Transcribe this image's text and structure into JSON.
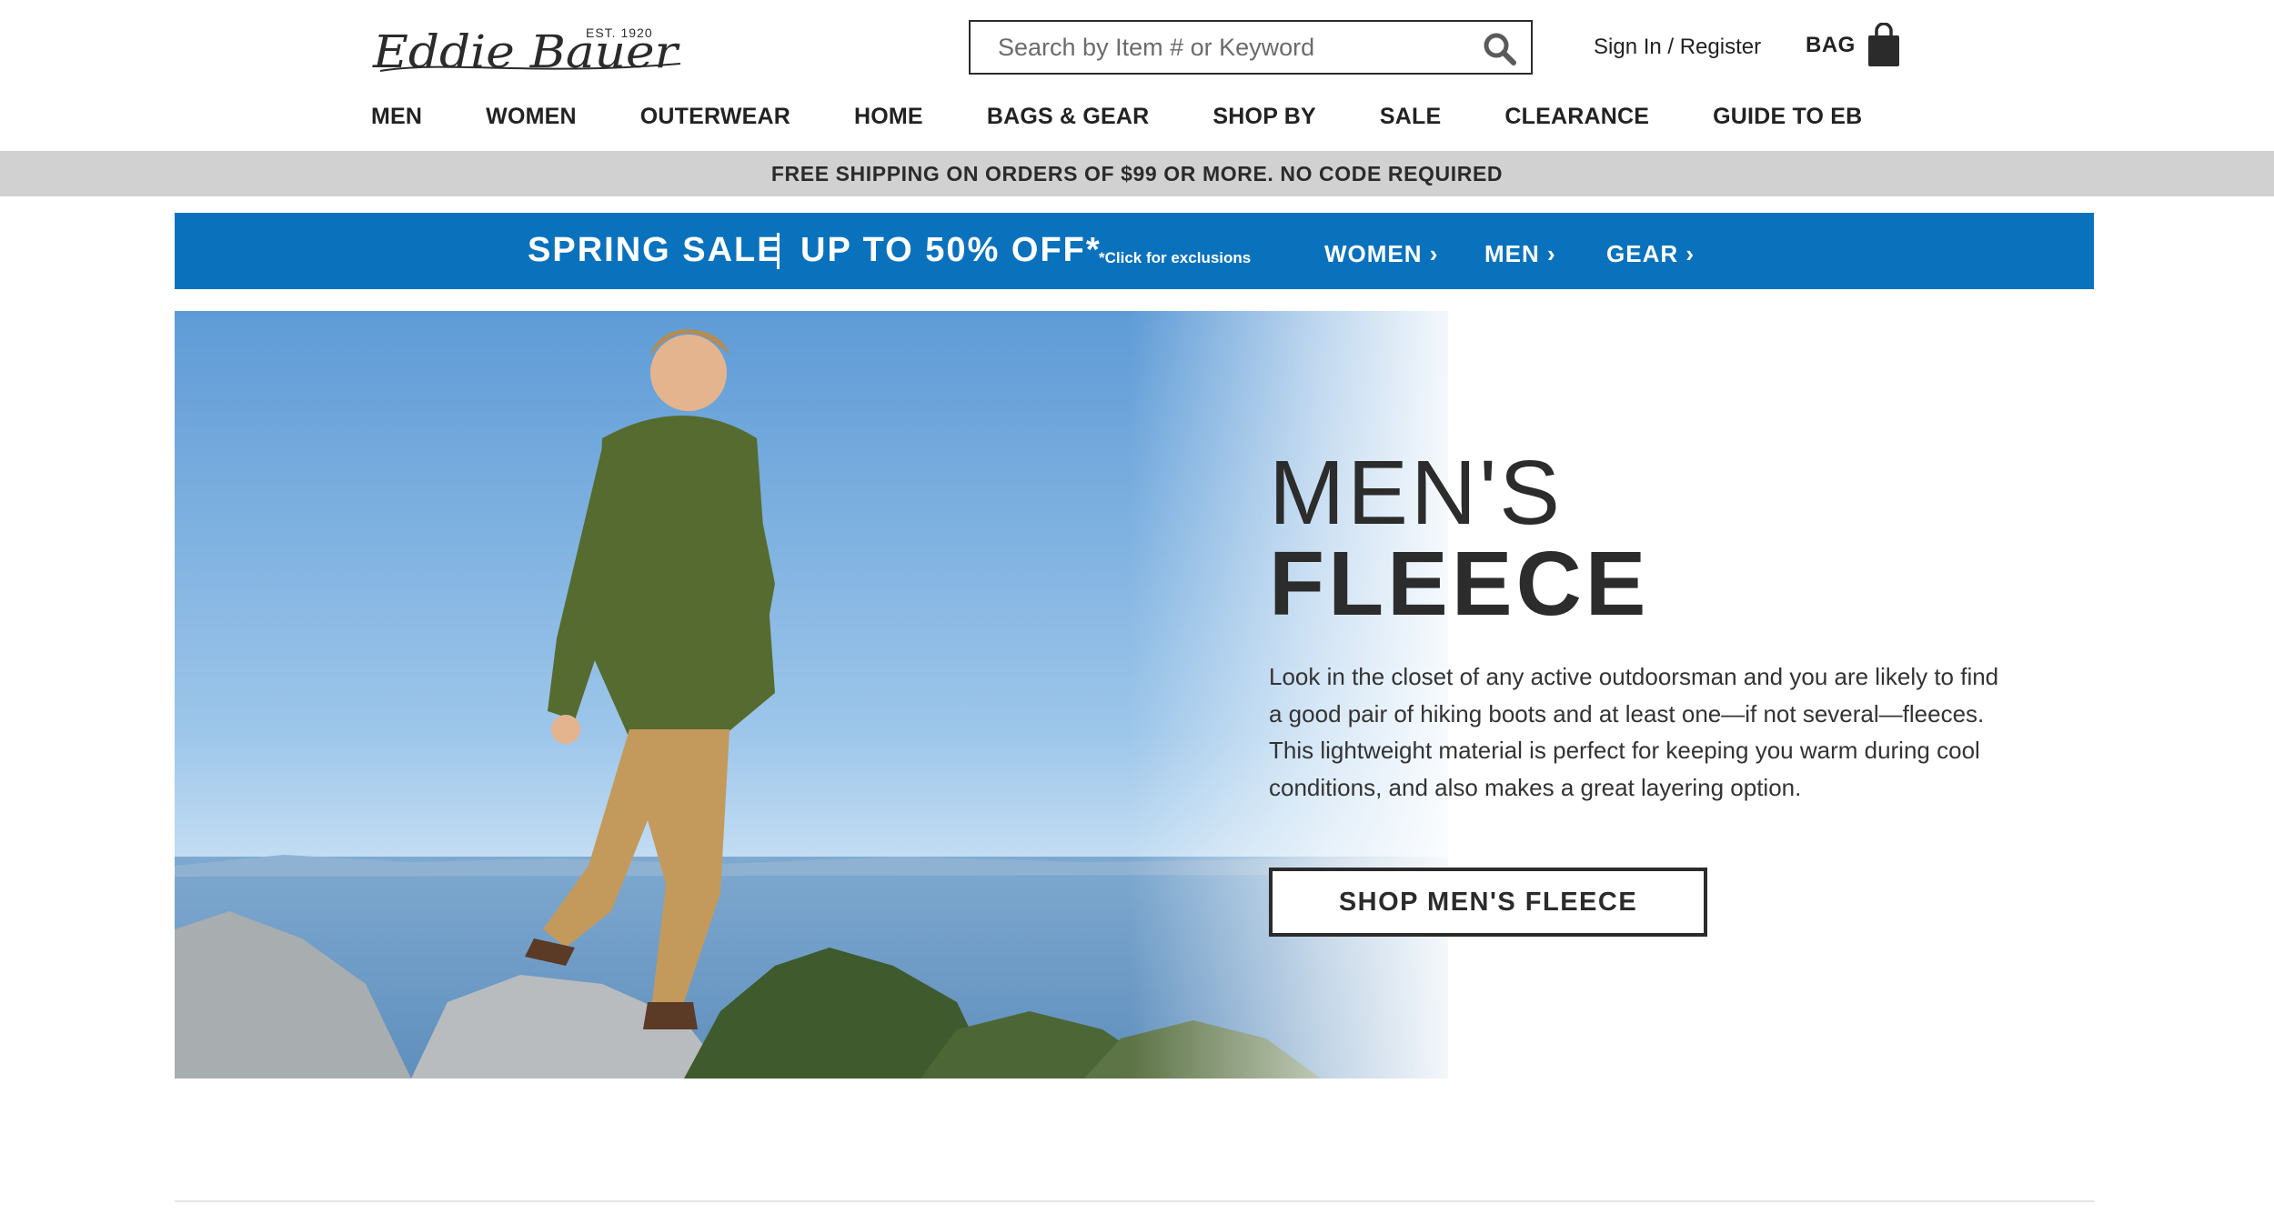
{
  "header": {
    "logo_text": "Eddie Bauer",
    "logo_est": "EST. 1920",
    "search_placeholder": "Search by Item # or Keyword",
    "signin_label": "Sign In / Register",
    "bag_label": "BAG"
  },
  "nav": {
    "items": [
      "MEN",
      "WOMEN",
      "OUTERWEAR",
      "HOME",
      "BAGS & GEAR",
      "SHOP BY",
      "SALE",
      "CLEARANCE",
      "GUIDE TO EB"
    ]
  },
  "shipping_bar": {
    "text": "FREE SHIPPING ON ORDERS OF $99 OR MORE. NO CODE REQUIRED"
  },
  "sale_banner": {
    "title": "SPRING SALE",
    "offer": "UP TO 50% OFF*",
    "note": "*Click for exclusions",
    "links": [
      "WOMEN ›",
      "MEN ›",
      "GEAR ›"
    ],
    "background": "#0a72bd"
  },
  "hero": {
    "title_line1": "MEN'S",
    "title_line2": "FLEECE",
    "description": "Look in the closet of any active outdoorsman and you are likely to find a good pair of hiking boots and at least one—if not several—fleeces. This lightweight material is perfect for keeping you warm during cool conditions, and also makes a great layering option.",
    "cta_label": "SHOP MEN'S FLEECE"
  },
  "icons": {
    "search": "search-icon",
    "bag": "shopping-bag-icon"
  }
}
